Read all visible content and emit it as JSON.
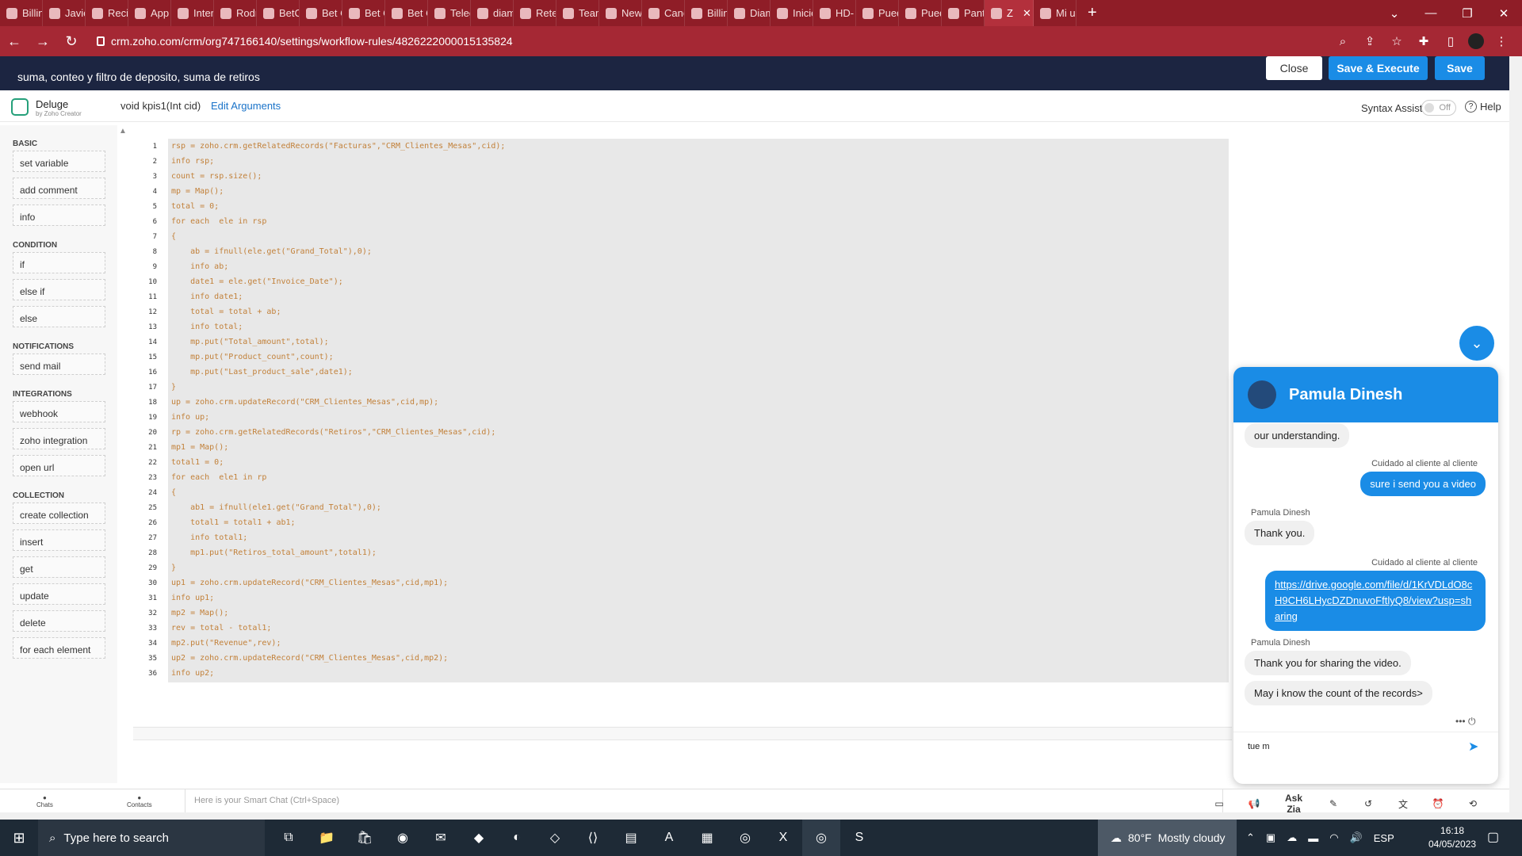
{
  "browser": {
    "tabs": [
      {
        "label": "Billin"
      },
      {
        "label": "Javie"
      },
      {
        "label": "Recil"
      },
      {
        "label": "App"
      },
      {
        "label": "Inter"
      },
      {
        "label": "Rodr"
      },
      {
        "label": "BetC"
      },
      {
        "label": "Bet C"
      },
      {
        "label": "Bet C"
      },
      {
        "label": "Bet C"
      },
      {
        "label": "Teleg"
      },
      {
        "label": "diam"
      },
      {
        "label": "Reter"
      },
      {
        "label": "Team"
      },
      {
        "label": "New"
      },
      {
        "label": "Canc"
      },
      {
        "label": "Billin"
      },
      {
        "label": "Diam"
      },
      {
        "label": "Inicio"
      },
      {
        "label": "HD-"
      },
      {
        "label": "Pued"
      },
      {
        "label": "Pued"
      },
      {
        "label": "Pant"
      },
      {
        "label": "Z"
      },
      {
        "label": "Mi u"
      }
    ],
    "active_tab_index": 23,
    "url": "crm.zoho.com/crm/org747166140/settings/workflow-rules/4826222000015135824"
  },
  "header": {
    "subtitle": "suma, conteo y filtro de deposito, suma de retiros",
    "close_label": "Close",
    "save_execute_label": "Save & Execute",
    "save_label": "Save",
    "accent": "#1a8ce6"
  },
  "editor_bar": {
    "product": "Deluge",
    "product_by": "by Zoho Creator",
    "signature": "void kpis1(Int cid)",
    "edit_args_label": "Edit Arguments",
    "syntax_assist_label": "Syntax Assist",
    "toggle_state": "Off",
    "help_label": "Help"
  },
  "palette": {
    "sections": [
      {
        "title": "BASIC",
        "items": [
          "set variable",
          "add comment",
          "info"
        ]
      },
      {
        "title": "CONDITION",
        "items": [
          "if",
          "else if",
          "else"
        ]
      },
      {
        "title": "NOTIFICATIONS",
        "items": [
          "send mail"
        ]
      },
      {
        "title": "INTEGRATIONS",
        "items": [
          "webhook",
          "zoho integration",
          "open url"
        ]
      },
      {
        "title": "COLLECTION",
        "items": [
          "create collection",
          "insert",
          "get",
          "update",
          "delete",
          "for each element"
        ]
      }
    ]
  },
  "code": {
    "lines": [
      "rsp = zoho.crm.getRelatedRecords(\"Facturas\",\"CRM_Clientes_Mesas\",cid);",
      "info rsp;",
      "count = rsp.size();",
      "mp = Map();",
      "total = 0;",
      "for each  ele in rsp",
      "{",
      "    ab = ifnull(ele.get(\"Grand_Total\"),0);",
      "    info ab;",
      "    date1 = ele.get(\"Invoice_Date\");",
      "    info date1;",
      "    total = total + ab;",
      "    info total;",
      "    mp.put(\"Total_amount\",total);",
      "    mp.put(\"Product_count\",count);",
      "    mp.put(\"Last_product_sale\",date1);",
      "}",
      "up = zoho.crm.updateRecord(\"CRM_Clientes_Mesas\",cid,mp);",
      "info up;",
      "rp = zoho.crm.getRelatedRecords(\"Retiros\",\"CRM_Clientes_Mesas\",cid);",
      "mp1 = Map();",
      "total1 = 0;",
      "for each  ele1 in rp",
      "{",
      "    ab1 = ifnull(ele1.get(\"Grand_Total\"),0);",
      "    total1 = total1 + ab1;",
      "    info total1;",
      "    mp1.put(\"Retiros_total_amount\",total1);",
      "}",
      "up1 = zoho.crm.updateRecord(\"CRM_Clientes_Mesas\",cid,mp1);",
      "info up1;",
      "mp2 = Map();",
      "rev = total - total1;",
      "mp2.put(\"Revenue\",rev);",
      "up2 = zoho.crm.updateRecord(\"CRM_Clientes_Mesas\",cid,mp2);",
      "info up2;"
    ]
  },
  "chat": {
    "agent_name": "Pamula Dinesh",
    "messages": [
      {
        "dir": "in",
        "text": "our understanding."
      },
      {
        "dir": "out",
        "sender": "Cuidado al cliente al cliente",
        "text": "sure i send you a video"
      },
      {
        "dir": "in",
        "sender": "Pamula Dinesh",
        "text": "Thank you."
      },
      {
        "dir": "out",
        "sender": "Cuidado al cliente al cliente",
        "text": "https://drive.google.com/file/d/1KrVDLdO8cH9CH6LHycDZDnuvoFftlyQ8/view?usp=sharing"
      },
      {
        "dir": "in",
        "sender": "Pamula Dinesh",
        "text": "Thank you for sharing the video."
      },
      {
        "dir": "in",
        "text": "May i know the count of the records>"
      }
    ],
    "input_value": "tue m"
  },
  "bottom_bar": {
    "chats_label": "Chats",
    "contacts_label": "Contacts",
    "smartchat_placeholder": "Here is your Smart Chat (Ctrl+Space)",
    "ask_zia_label": "Ask Zia"
  },
  "taskbar": {
    "search_placeholder": "Type here to search",
    "weather_temp": "80°F",
    "weather_text": "Mostly cloudy",
    "lang": "ESP",
    "time": "16:18",
    "date": "04/05/2023"
  }
}
